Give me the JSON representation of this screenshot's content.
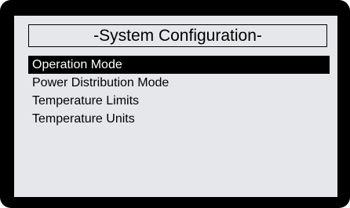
{
  "screen": {
    "title": "-System Configuration-",
    "selected_index": 0,
    "menu_items": [
      {
        "label": "Operation Mode"
      },
      {
        "label": "Power Distribution Mode"
      },
      {
        "label": "Temperature Limits"
      },
      {
        "label": "Temperature Units"
      }
    ]
  },
  "colors": {
    "bezel": "#000000",
    "screen_background": "#e5e7ea",
    "highlight_background": "#000000",
    "highlight_text": "#ffffff"
  }
}
